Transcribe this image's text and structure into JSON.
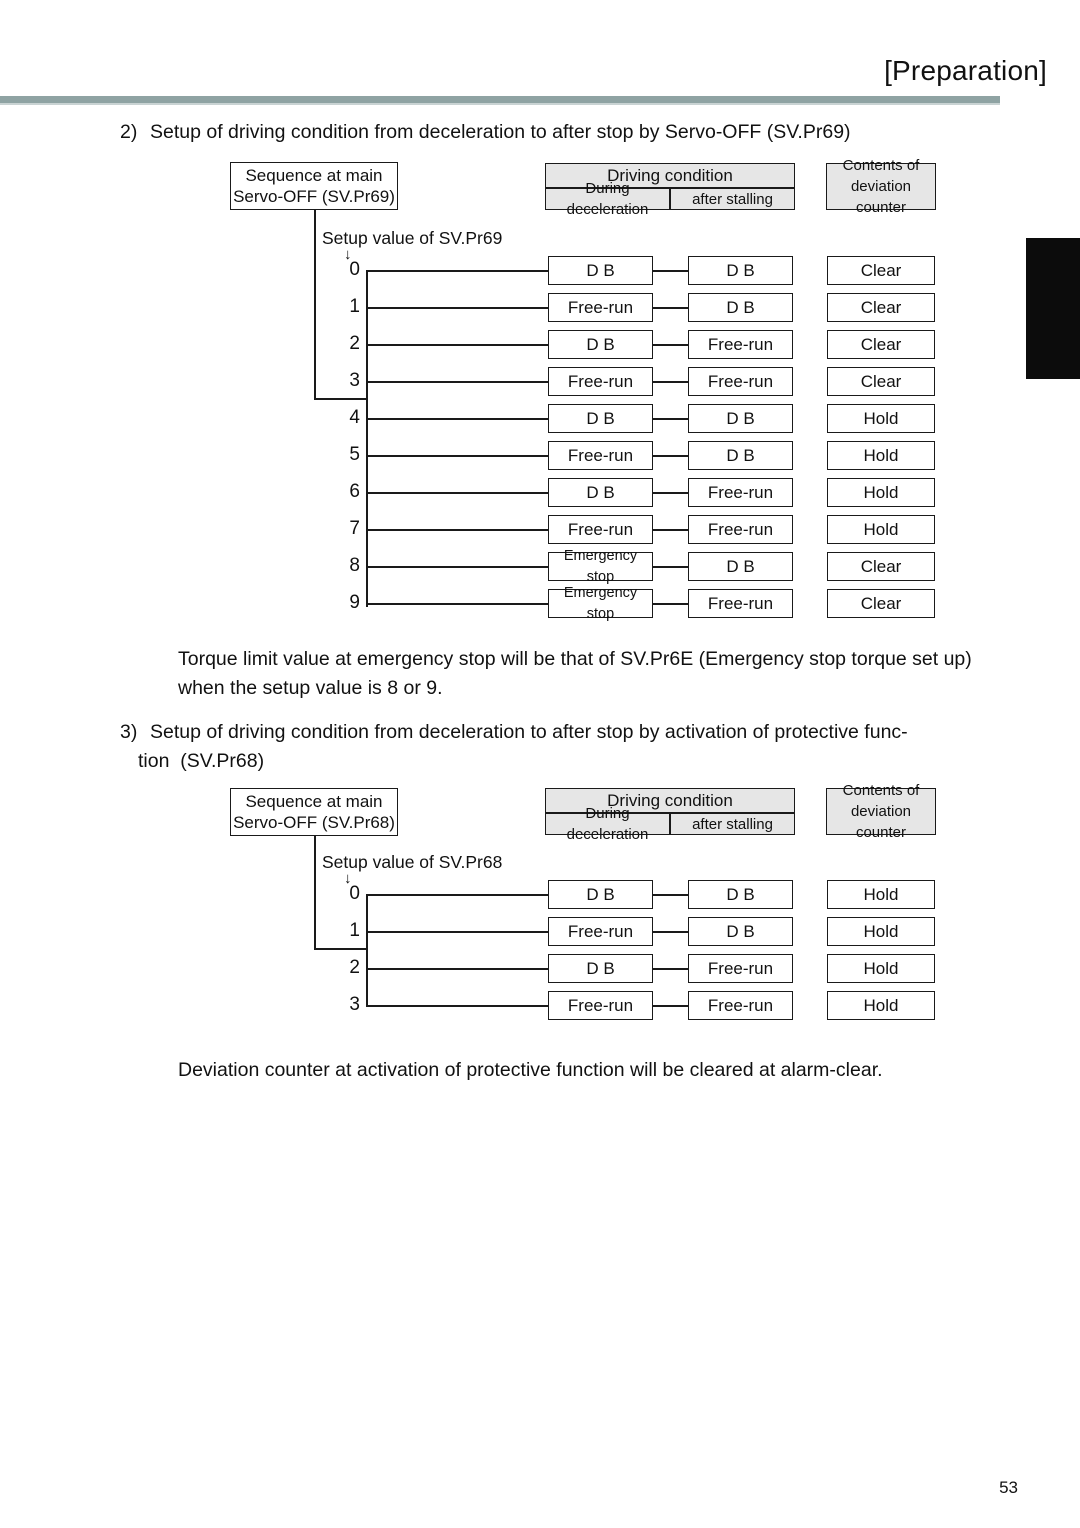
{
  "header": {
    "title": "[Preparation]",
    "rule_color": "#8fa3a3"
  },
  "thumb_tab": {
    "color": "#0c0c0c"
  },
  "sections": [
    {
      "number": "2)",
      "text": "Setup of driving condition from deceleration to after stop by Servo-OFF (SV.Pr69)"
    },
    {
      "number": "3)",
      "line1": "Setup of driving condition from deceleration to after stop by activation of protective func-",
      "line2": "tion  (SV.Pr68)"
    }
  ],
  "notes": {
    "note1_line1": "Torque limit value at emergency stop will be that of SV.Pr6E (Emergency stop torque set up)",
    "note1_line2": "when the setup value is 8 or 9.",
    "note2": "Deviation counter at activation of protective function will be cleared at alarm-clear."
  },
  "diagram1": {
    "sequence_box_line1": "Sequence at main",
    "sequence_box_line2": "Servo-OFF (SV.Pr69)",
    "setup_caption": "Setup value of SV.Pr69",
    "arrow": "↓",
    "headers": {
      "driving_condition": "Driving condition",
      "during_deceleration": "During deceleration",
      "after_stalling": "after stalling",
      "contents_line1": "Contents of",
      "contents_line2": "deviation",
      "contents_line3": "counter"
    },
    "rows": [
      {
        "value": "0",
        "during": "D  B",
        "after": "D  B",
        "counter": "Clear"
      },
      {
        "value": "1",
        "during": "Free-run",
        "after": "D  B",
        "counter": "Clear"
      },
      {
        "value": "2",
        "during": "D  B",
        "after": "Free-run",
        "counter": "Clear"
      },
      {
        "value": "3",
        "during": "Free-run",
        "after": "Free-run",
        "counter": "Clear"
      },
      {
        "value": "4",
        "during": "D  B",
        "after": "D  B",
        "counter": "Hold"
      },
      {
        "value": "5",
        "during": "Free-run",
        "after": "D  B",
        "counter": "Hold"
      },
      {
        "value": "6",
        "during": "D  B",
        "after": "Free-run",
        "counter": "Hold"
      },
      {
        "value": "7",
        "during": "Free-run",
        "after": "Free-run",
        "counter": "Hold"
      },
      {
        "value": "8",
        "during": "Emergency stop",
        "after": "D  B",
        "counter": "Clear"
      },
      {
        "value": "9",
        "during": "Emergency stop",
        "after": "Free-run",
        "counter": "Clear"
      }
    ]
  },
  "diagram2": {
    "sequence_box_line1": "Sequence at main",
    "sequence_box_line2": "Servo-OFF (SV.Pr68)",
    "setup_caption": "Setup value of SV.Pr68",
    "arrow": "↓",
    "headers": {
      "driving_condition": "Driving condition",
      "during_deceleration": "During deceleration",
      "after_stalling": "after stalling",
      "contents_line1": "Contents of",
      "contents_line2": "deviation",
      "contents_line3": "counter"
    },
    "rows": [
      {
        "value": "0",
        "during": "D  B",
        "after": "D  B",
        "counter": "Hold"
      },
      {
        "value": "1",
        "during": "Free-run",
        "after": "D  B",
        "counter": "Hold"
      },
      {
        "value": "2",
        "during": "D  B",
        "after": "Free-run",
        "counter": "Hold"
      },
      {
        "value": "3",
        "during": "Free-run",
        "after": "Free-run",
        "counter": "Hold"
      }
    ]
  },
  "footer": {
    "page_number": "53"
  }
}
